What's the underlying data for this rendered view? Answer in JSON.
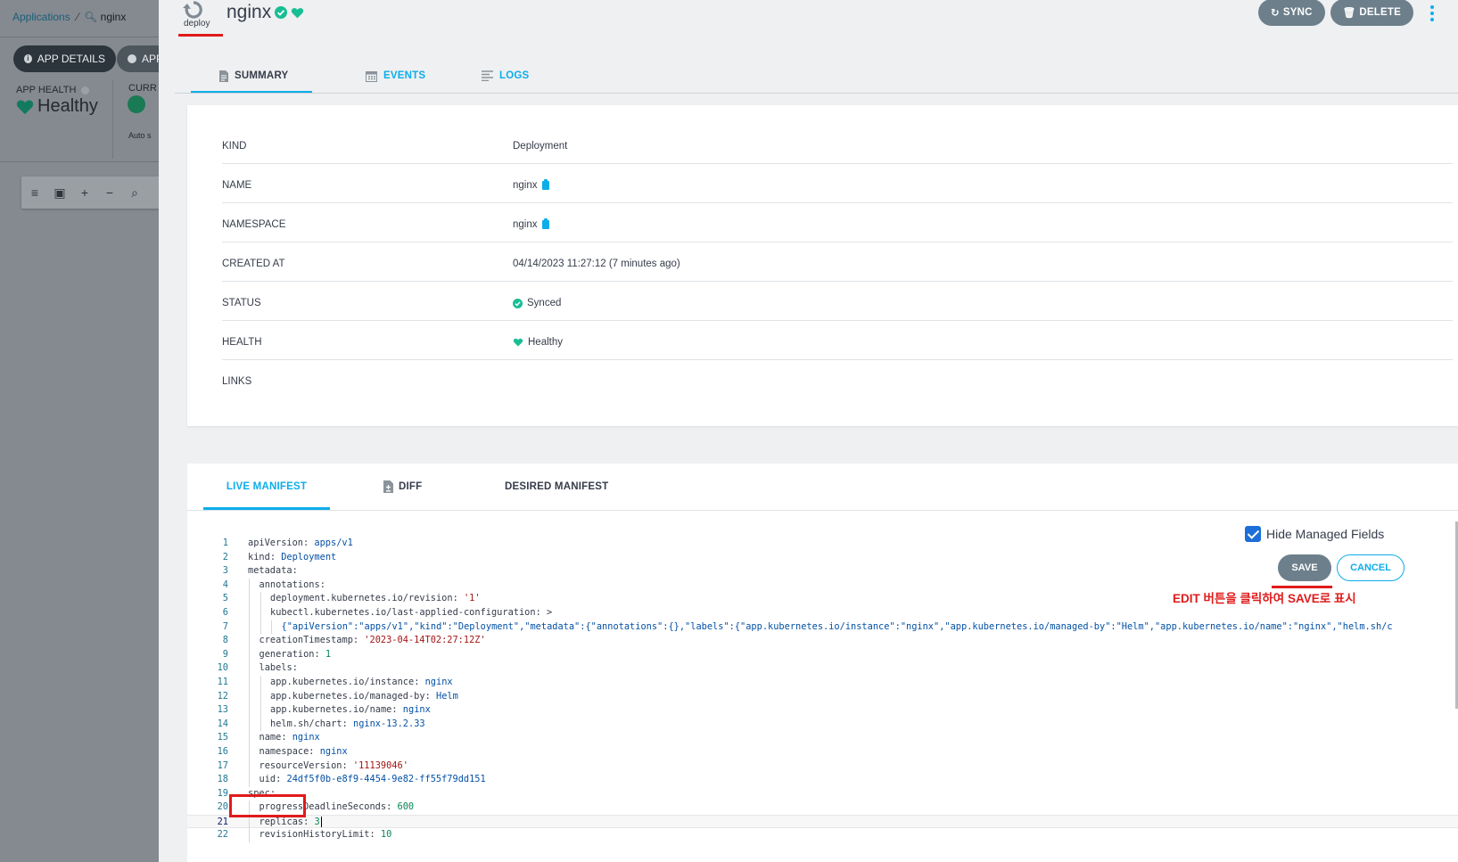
{
  "background": {
    "breadcrumb": {
      "link": "Applications",
      "current": "nginx"
    },
    "tabs": {
      "details": "APP DETAILS",
      "app_partial": "APP"
    },
    "health": {
      "label": "APP HEALTH",
      "value": "Healthy"
    },
    "current_partial": "CURR",
    "auto_partial": "Auto s"
  },
  "panel": {
    "kind_label": "deploy",
    "resource_name": "nginx",
    "actions": {
      "sync": "SYNC",
      "delete": "DELETE"
    },
    "tabs": {
      "summary": "SUMMARY",
      "events": "EVENTS",
      "logs": "LOGS"
    },
    "summary": {
      "rows": [
        {
          "key": "KIND",
          "value": "Deployment"
        },
        {
          "key": "NAME",
          "value": "nginx"
        },
        {
          "key": "NAMESPACE",
          "value": "nginx"
        },
        {
          "key": "CREATED AT",
          "value": "04/14/2023 11:27:12  (7 minutes ago)"
        },
        {
          "key": "STATUS",
          "value": "Synced"
        },
        {
          "key": "HEALTH",
          "value": "Healthy"
        },
        {
          "key": "LINKS",
          "value": ""
        }
      ]
    },
    "manifest_tabs": {
      "live": "LIVE MANIFEST",
      "diff": "DIFF",
      "desired": "DESIRED MANIFEST"
    },
    "hide_managed_fields": "Hide Managed Fields",
    "save": "SAVE",
    "cancel": "CANCEL",
    "annotation": "EDIT 버튼을 클릭하여 SAVE로 표시",
    "colors": {
      "accent": "#0dadea",
      "healthy": "#18be94",
      "annotation_red": "#e01b1b",
      "button_gray": "#6d7f8b"
    },
    "manifest_lines": [
      {
        "n": "1",
        "indent": 0,
        "key": "apiVersion",
        "val": "apps/v1",
        "type": "plain"
      },
      {
        "n": "2",
        "indent": 0,
        "key": "kind",
        "val": "Deployment",
        "type": "plain"
      },
      {
        "n": "3",
        "indent": 0,
        "key": "metadata",
        "val": "",
        "type": "plain"
      },
      {
        "n": "4",
        "indent": 1,
        "key": "annotations",
        "val": "",
        "type": "plain"
      },
      {
        "n": "5",
        "indent": 2,
        "key": "deployment.kubernetes.io/revision",
        "val": "'1'",
        "type": "str"
      },
      {
        "n": "6",
        "indent": 2,
        "key": "kubectl.kubernetes.io/last-applied-configuration",
        "val": ">",
        "type": "key"
      },
      {
        "n": "7",
        "indent": 3,
        "key": "",
        "val": "{\"apiVersion\":\"apps/v1\",\"kind\":\"Deployment\",\"metadata\":{\"annotations\":{},\"labels\":{\"app.kubernetes.io/instance\":\"nginx\",\"app.kubernetes.io/managed-by\":\"Helm\",\"app.kubernetes.io/name\":\"nginx\",\"helm.sh/c",
        "type": "plain"
      },
      {
        "n": "8",
        "indent": 1,
        "key": "creationTimestamp",
        "val": "'2023-04-14T02:27:12Z'",
        "type": "str"
      },
      {
        "n": "9",
        "indent": 1,
        "key": "generation",
        "val": "1",
        "type": "num"
      },
      {
        "n": "10",
        "indent": 1,
        "key": "labels",
        "val": "",
        "type": "plain"
      },
      {
        "n": "11",
        "indent": 2,
        "key": "app.kubernetes.io/instance",
        "val": "nginx",
        "type": "plain"
      },
      {
        "n": "12",
        "indent": 2,
        "key": "app.kubernetes.io/managed-by",
        "val": "Helm",
        "type": "plain"
      },
      {
        "n": "13",
        "indent": 2,
        "key": "app.kubernetes.io/name",
        "val": "nginx",
        "type": "plain"
      },
      {
        "n": "14",
        "indent": 2,
        "key": "helm.sh/chart",
        "val": "nginx-13.2.33",
        "type": "plain"
      },
      {
        "n": "15",
        "indent": 1,
        "key": "name",
        "val": "nginx",
        "type": "plain"
      },
      {
        "n": "16",
        "indent": 1,
        "key": "namespace",
        "val": "nginx",
        "type": "plain"
      },
      {
        "n": "17",
        "indent": 1,
        "key": "resourceVersion",
        "val": "'11139046'",
        "type": "str"
      },
      {
        "n": "18",
        "indent": 1,
        "key": "uid",
        "val": "24df5f0b-e8f9-4454-9e82-ff55f79dd151",
        "type": "plain"
      },
      {
        "n": "19",
        "indent": 0,
        "key": "spec",
        "val": "",
        "type": "plain"
      },
      {
        "n": "20",
        "indent": 1,
        "key": "progressDeadlineSeconds",
        "val": "600",
        "type": "num"
      },
      {
        "n": "21",
        "indent": 1,
        "key": "replicas",
        "val": "3",
        "type": "num",
        "active": true
      },
      {
        "n": "22",
        "indent": 1,
        "key": "revisionHistoryLimit",
        "val": "10",
        "type": "num"
      }
    ]
  }
}
